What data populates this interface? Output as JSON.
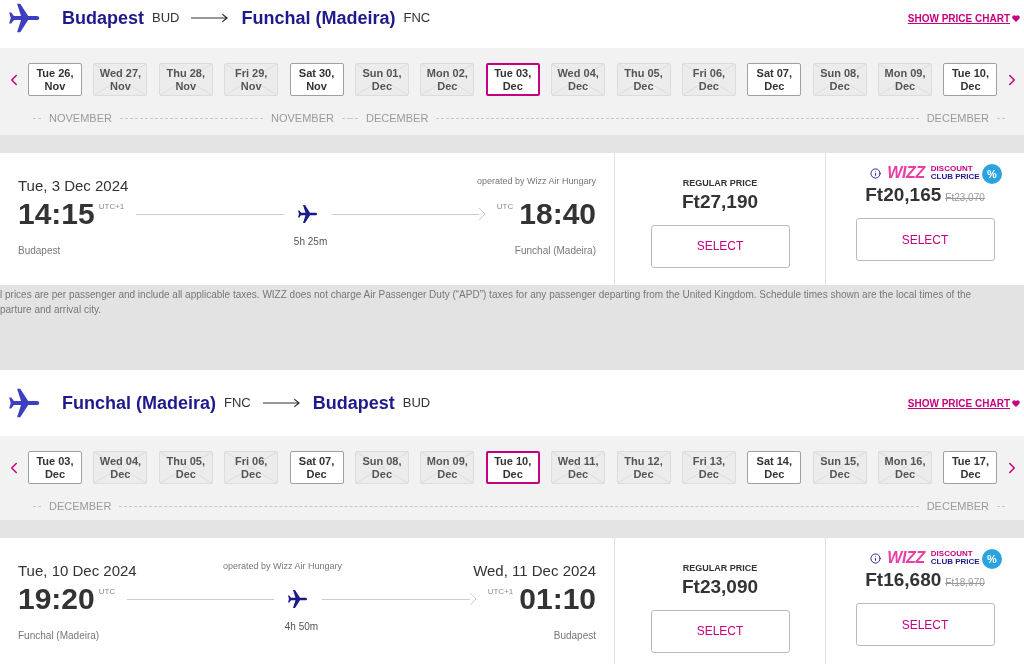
{
  "legs": [
    {
      "from": {
        "city": "Budapest",
        "code": "BUD"
      },
      "to": {
        "city": "Funchal (Madeira)",
        "code": "FNC"
      },
      "price_chart_link": "SHOW PRICE CHART",
      "dates": [
        {
          "day": "Tue 26,",
          "month": "Nov",
          "available": true,
          "selected": false
        },
        {
          "day": "Wed 27,",
          "month": "Nov",
          "available": false,
          "selected": false
        },
        {
          "day": "Thu 28,",
          "month": "Nov",
          "available": false,
          "selected": false
        },
        {
          "day": "Fri 29,",
          "month": "Nov",
          "available": false,
          "selected": false
        },
        {
          "day": "Sat 30,",
          "month": "Nov",
          "available": true,
          "selected": false
        },
        {
          "day": "Sun 01,",
          "month": "Dec",
          "available": false,
          "selected": false
        },
        {
          "day": "Mon 02,",
          "month": "Dec",
          "available": false,
          "selected": false
        },
        {
          "day": "Tue 03,",
          "month": "Dec",
          "available": true,
          "selected": true
        },
        {
          "day": "Wed 04,",
          "month": "Dec",
          "available": false,
          "selected": false
        },
        {
          "day": "Thu 05,",
          "month": "Dec",
          "available": false,
          "selected": false
        },
        {
          "day": "Fri 06,",
          "month": "Dec",
          "available": false,
          "selected": false
        },
        {
          "day": "Sat 07,",
          "month": "Dec",
          "available": true,
          "selected": false
        },
        {
          "day": "Sun 08,",
          "month": "Dec",
          "available": false,
          "selected": false
        },
        {
          "day": "Mon 09,",
          "month": "Dec",
          "available": false,
          "selected": false
        },
        {
          "day": "Tue 10,",
          "month": "Dec",
          "available": true,
          "selected": false
        }
      ],
      "month_groups": [
        {
          "start": "NOVEMBER",
          "end": "NOVEMBER"
        },
        {
          "start": "DECEMBER",
          "end": "DECEMBER"
        }
      ],
      "flight": {
        "departure_date": "Tue, 3 Dec 2024",
        "operator": "operated by Wizz Air Hungary",
        "departure_time": "14:15",
        "departure_tz": "UTC+1",
        "arrival_time": "18:40",
        "arrival_tz": "UTC",
        "duration": "5h 25m",
        "departure_city": "Budapest",
        "arrival_city": "Funchal (Madeira)"
      },
      "regular": {
        "label": "REGULAR PRICE",
        "price": "Ft27,190",
        "button": "SELECT"
      },
      "club": {
        "brand": "WIZZ",
        "line1": "DISCOUNT",
        "line2": "CLUB PRICE",
        "badge": "%",
        "price": "Ft20,165",
        "old_price": "Ft23,070",
        "button": "SELECT"
      },
      "disclaimer": [
        "l prices are per passenger and include all applicable taxes. WIZZ does not charge Air Passenger Duty (“APD”) taxes for any passenger departing from the United Kingdom. Schedule times shown are the local times of the",
        "parture and arrival city."
      ]
    },
    {
      "from": {
        "city": "Funchal (Madeira)",
        "code": "FNC"
      },
      "to": {
        "city": "Budapest",
        "code": "BUD"
      },
      "price_chart_link": "SHOW PRICE CHART",
      "dates": [
        {
          "day": "Tue 03,",
          "month": "Dec",
          "available": true,
          "selected": false
        },
        {
          "day": "Wed 04,",
          "month": "Dec",
          "available": false,
          "selected": false
        },
        {
          "day": "Thu 05,",
          "month": "Dec",
          "available": false,
          "selected": false
        },
        {
          "day": "Fri 06,",
          "month": "Dec",
          "available": false,
          "selected": false
        },
        {
          "day": "Sat 07,",
          "month": "Dec",
          "available": true,
          "selected": false
        },
        {
          "day": "Sun 08,",
          "month": "Dec",
          "available": false,
          "selected": false
        },
        {
          "day": "Mon 09,",
          "month": "Dec",
          "available": false,
          "selected": false
        },
        {
          "day": "Tue 10,",
          "month": "Dec",
          "available": true,
          "selected": true
        },
        {
          "day": "Wed 11,",
          "month": "Dec",
          "available": false,
          "selected": false
        },
        {
          "day": "Thu 12,",
          "month": "Dec",
          "available": false,
          "selected": false
        },
        {
          "day": "Fri 13,",
          "month": "Dec",
          "available": false,
          "selected": false
        },
        {
          "day": "Sat 14,",
          "month": "Dec",
          "available": true,
          "selected": false
        },
        {
          "day": "Sun 15,",
          "month": "Dec",
          "available": false,
          "selected": false
        },
        {
          "day": "Mon 16,",
          "month": "Dec",
          "available": false,
          "selected": false
        },
        {
          "day": "Tue 17,",
          "month": "Dec",
          "available": true,
          "selected": false
        }
      ],
      "month_groups": [
        {
          "start": "DECEMBER",
          "end": "DECEMBER"
        }
      ],
      "flight": {
        "departure_date": "Tue, 10 Dec 2024",
        "arrival_date": "Wed, 11 Dec 2024",
        "operator": "operated by Wizz Air Hungary",
        "departure_time": "19:20",
        "departure_tz": "UTC",
        "arrival_time": "01:10",
        "arrival_tz": "UTC+1",
        "duration": "4h 50m",
        "departure_city": "Funchal (Madeira)",
        "arrival_city": "Budapest"
      },
      "regular": {
        "label": "REGULAR PRICE",
        "price": "Ft23,090",
        "button": "SELECT"
      },
      "club": {
        "brand": "WIZZ",
        "line1": "DISCOUNT",
        "line2": "CLUB PRICE",
        "badge": "%",
        "price": "Ft16,680",
        "old_price": "Ft18,970",
        "button": "SELECT"
      }
    }
  ]
}
